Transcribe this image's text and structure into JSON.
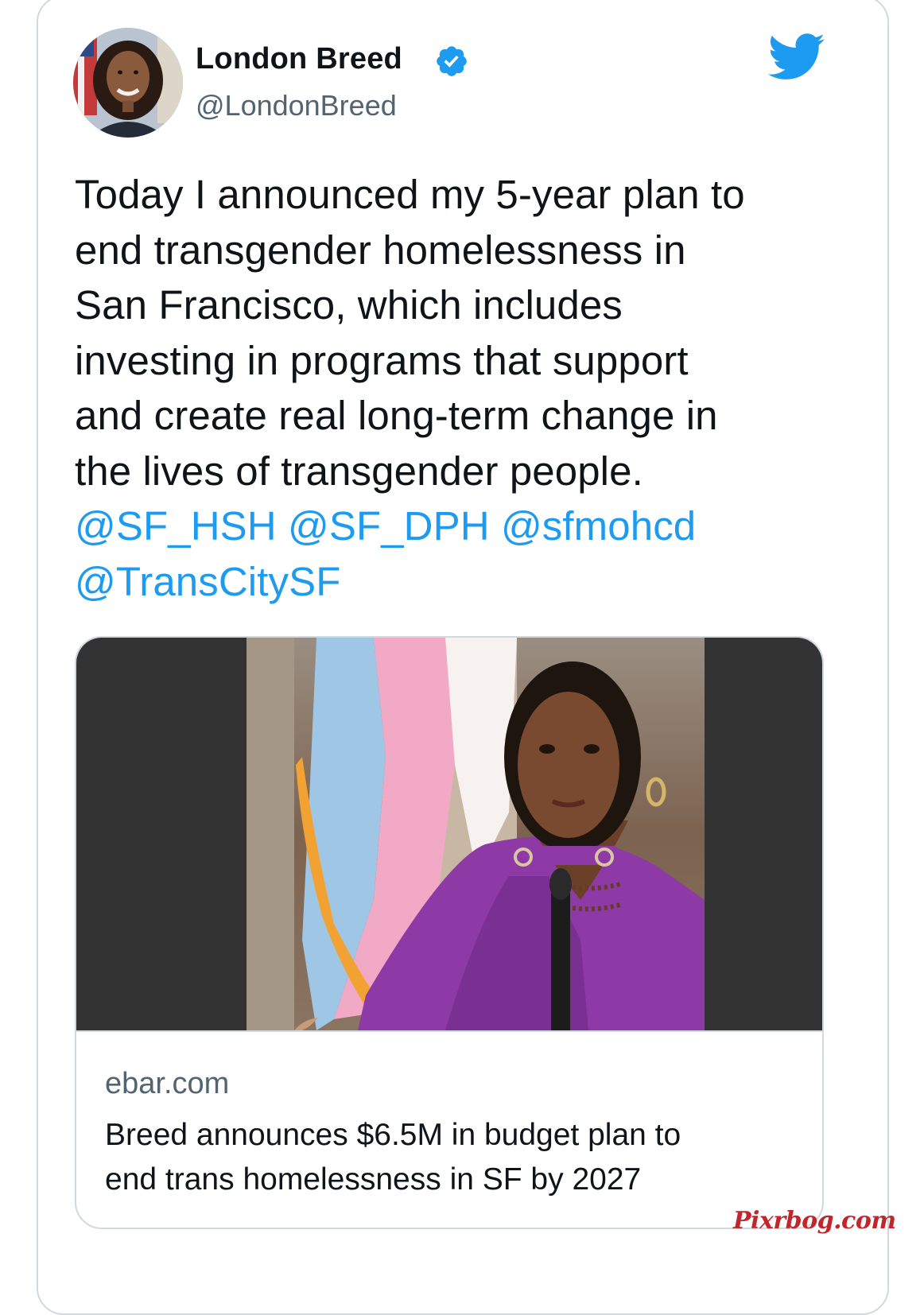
{
  "author": {
    "name": "London Breed",
    "handle": "@LondonBreed",
    "verified": true
  },
  "tweet": {
    "text_lines": [
      "Today I announced my 5-year plan to",
      "end transgender homelessness in",
      "San Francisco, which includes",
      "investing in programs that support",
      "and create real long-term change in",
      "the lives of transgender people."
    ],
    "mentions": [
      "@SF_HSH",
      "@SF_DPH",
      "@sfmohcd",
      "@TransCitySF"
    ]
  },
  "link_card": {
    "domain": "ebar.com",
    "title_lines": [
      "Breed announces $6.5M in budget plan to",
      "end trans homelessness in SF by 2027"
    ]
  },
  "watermark": "Pixrbog.com",
  "icons": {
    "platform": "twitter-bird-icon",
    "verified": "verified-badge-icon"
  },
  "colors": {
    "text": "#0f1419",
    "secondary": "#536471",
    "link": "#1d9bf0",
    "border": "#cfd9de",
    "verified": "#1d9bf0",
    "card_media_bg": "#333333",
    "watermark": "#c1262c"
  }
}
